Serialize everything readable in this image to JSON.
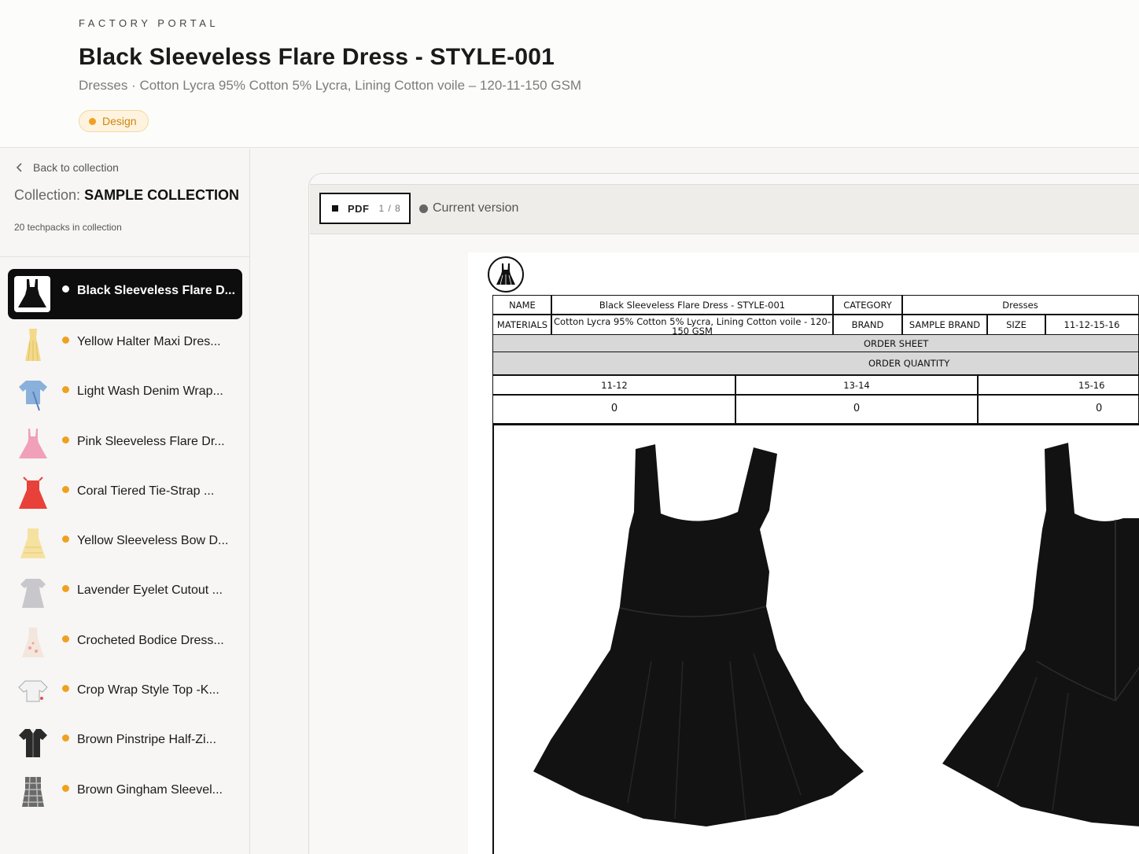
{
  "header": {
    "eyebrow": "FACTORY PORTAL",
    "title": "Black Sleeveless Flare Dress - STYLE-001",
    "subtitle": "Dresses · Cotton Lycra 95% Cotton 5% Lycra, Lining Cotton voile – 120-11-150 GSM",
    "badge": "Design",
    "badge_color": "#f0a020"
  },
  "sidebar": {
    "back_label": "Back to collection",
    "collection_prefix": "Collection:",
    "collection_name": "SAMPLE COLLECTION",
    "count_label": "20 techpacks in collection",
    "items": [
      {
        "label": "Black Sleeveless Flare D...",
        "icon": "black-dress",
        "active": true
      },
      {
        "label": "Yellow Halter Maxi Dres...",
        "icon": "yellow-maxi-dress"
      },
      {
        "label": "Light Wash Denim Wrap...",
        "icon": "denim-wrap-top"
      },
      {
        "label": "Pink Sleeveless Flare Dr...",
        "icon": "pink-dress"
      },
      {
        "label": "Coral Tiered Tie-Strap ...",
        "icon": "coral-dress"
      },
      {
        "label": "Yellow Sleeveless Bow D...",
        "icon": "yellow-dress"
      },
      {
        "label": "Lavender Eyelet Cutout ...",
        "icon": "lavender-dress"
      },
      {
        "label": "Crocheted Bodice Dress...",
        "icon": "crochet-dress"
      },
      {
        "label": "Crop Wrap Style Top -K...",
        "icon": "crop-top"
      },
      {
        "label": "Brown Pinstripe Half-Zi...",
        "icon": "pinstripe-top"
      },
      {
        "label": "Brown Gingham Sleevel...",
        "icon": "gingham-top"
      }
    ]
  },
  "viewer": {
    "pdf_label": "PDF",
    "page_indicator": "1 / 8",
    "version_label": "Current version"
  },
  "document": {
    "name_label": "NAME",
    "name_value": "Black Sleeveless Flare Dress - STYLE-001",
    "category_label": "CATEGORY",
    "category_value": "Dresses",
    "materials_label": "MATERIALS",
    "materials_value": "Cotton Lycra 95% Cotton 5% Lycra, Lining Cotton voile - 120-150 GSM",
    "brand_label": "BRAND",
    "brand_value": "SAMPLE BRAND",
    "size_label": "SIZE",
    "size_value": "11-12-15-16",
    "order_sheet": "ORDER SHEET",
    "order_quantity": "ORDER QUANTITY",
    "sizes": [
      "11-12",
      "13-14",
      "15-16"
    ],
    "quantities": [
      "0",
      "0",
      "0"
    ]
  }
}
